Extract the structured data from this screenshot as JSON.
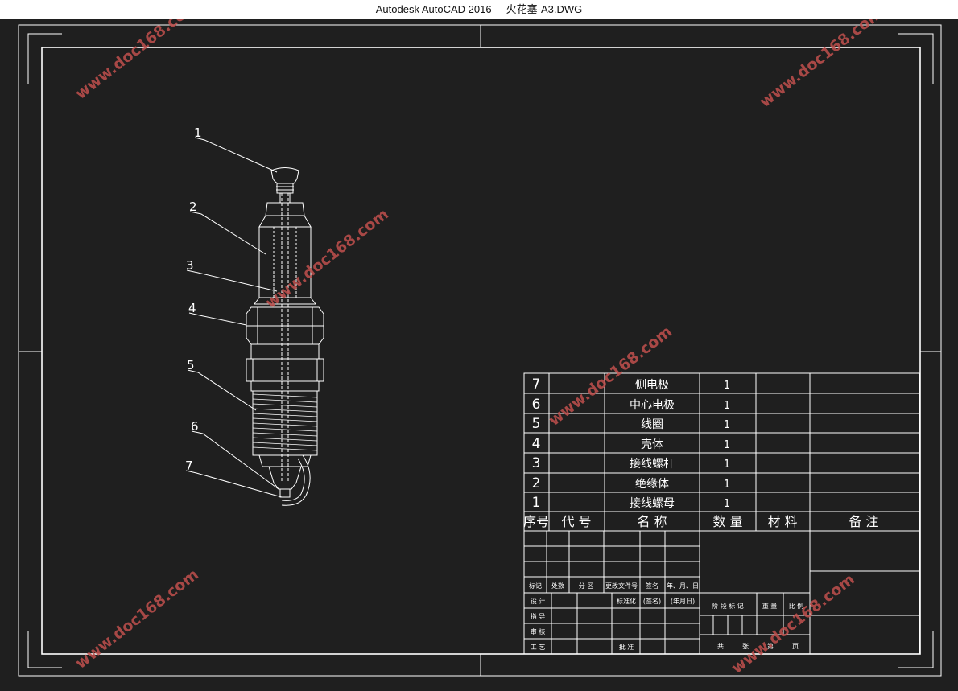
{
  "window": {
    "title": "Autodesk AutoCAD 2016     火花塞-A3.DWG"
  },
  "colors": {
    "background": "#1f1f1f",
    "lines": "#ffffff",
    "watermark": "#c0504d",
    "titlebar": "#ffffff"
  },
  "callouts": [
    "1",
    "2",
    "3",
    "4",
    "5",
    "6",
    "7"
  ],
  "parts_list": {
    "rows": [
      {
        "no": "7",
        "code": "",
        "name": "侧电极",
        "qty": "1",
        "material": "",
        "note": ""
      },
      {
        "no": "6",
        "code": "",
        "name": "中心电极",
        "qty": "1",
        "material": "",
        "note": ""
      },
      {
        "no": "5",
        "code": "",
        "name": "线圈",
        "qty": "1",
        "material": "",
        "note": ""
      },
      {
        "no": "4",
        "code": "",
        "name": "壳体",
        "qty": "1",
        "material": "",
        "note": ""
      },
      {
        "no": "3",
        "code": "",
        "name": "接线螺杆",
        "qty": "1",
        "material": "",
        "note": ""
      },
      {
        "no": "2",
        "code": "",
        "name": "绝缘体",
        "qty": "1",
        "material": "",
        "note": ""
      },
      {
        "no": "1",
        "code": "",
        "name": "接线螺母",
        "qty": "1",
        "material": "",
        "note": ""
      }
    ],
    "header": {
      "no": "序号",
      "code": "代 号",
      "name": "名 称",
      "qty": "数 量",
      "material": "材 料",
      "note": "备     注"
    }
  },
  "title_block": {
    "rev_labels": [
      "标记",
      "处数",
      "分 区",
      "更改文件号",
      "签名",
      "年、月、日"
    ],
    "sign_labels": [
      "设 计",
      "指 导",
      "审 核",
      "工 艺"
    ],
    "std_label": "标准化",
    "sign_hint": "(签名)",
    "date_hint": "(年月日)",
    "approve_label": "批 准",
    "stage_label": "阶 段 标 记",
    "weight_label": "重 量",
    "scale_label": "比 例",
    "sheets_total": "共",
    "sheets_label": "张",
    "sheet_no": "第",
    "page_label": "页"
  },
  "watermark": "www.doc168.com"
}
